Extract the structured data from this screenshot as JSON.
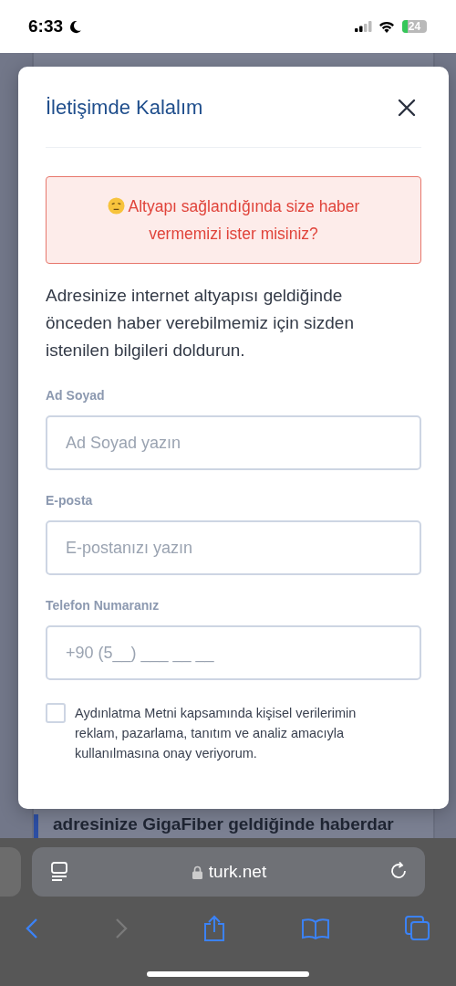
{
  "status_bar": {
    "time": "6:33",
    "battery": "24"
  },
  "background_page": {
    "text": "adresinize GigaFiber geldiğinde haberdar"
  },
  "modal": {
    "title": "İletişimde Kalalım",
    "alert": "Altyapı sağlandığında size haber vermemizi ister misiniz?",
    "intro": "Adresinize internet altyapısı geldiğinde önceden haber verebilmemiz için sizden istenilen bilgileri doldurun.",
    "fields": [
      {
        "label": "Ad Soyad",
        "placeholder": "Ad Soyad yazın"
      },
      {
        "label": "E-posta",
        "placeholder": "E-postanızı yazın"
      },
      {
        "label": "Telefon Numaranız",
        "placeholder": "+90 (5__) ___ __ __"
      }
    ],
    "consent": {
      "text": "Aydınlatma Metni kapsamında kişisel verilerimin reklam, pazarlama, tanıtım ve analiz amacıyla kullanılmasına onay veriyorum.",
      "checked": false
    }
  },
  "browser": {
    "url": "turk.net"
  }
}
